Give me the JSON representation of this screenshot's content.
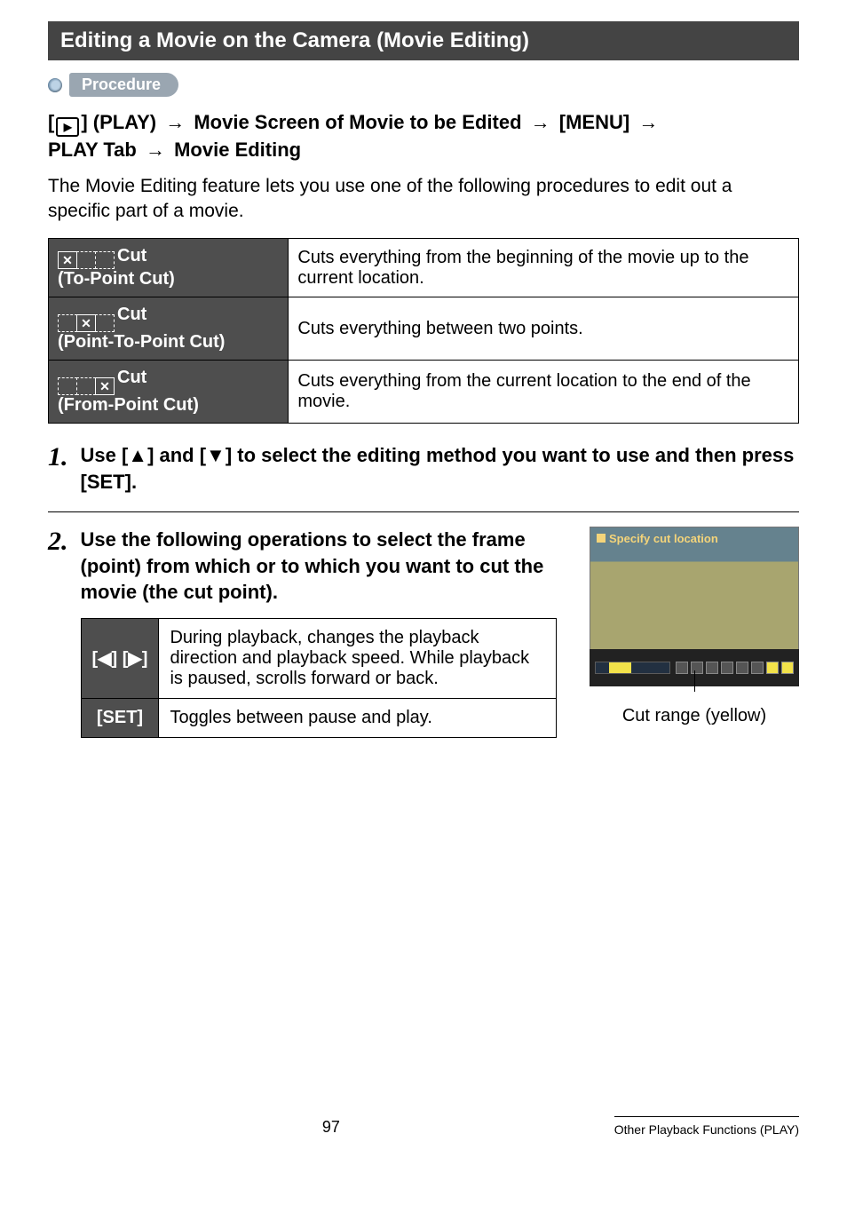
{
  "section_title": "Editing a Movie on the Camera (Movie Editing)",
  "procedure_label": "Procedure",
  "proc_line": {
    "pre": "[",
    "icon_glyph": "▶",
    "post1": "] (PLAY)",
    "seg1": "Movie Screen of Movie to be Edited",
    "seg2": "[MENU]",
    "line2a": "PLAY Tab",
    "line2b": "Movie Editing",
    "arrow": "→"
  },
  "intro": "The Movie Editing feature lets you use one of the following procedures to edit out a specific part of a movie.",
  "cut_table": [
    {
      "title": "Cut",
      "sub": "(To-Point Cut)",
      "desc": "Cuts everything from the beginning of the movie up to the current location.",
      "segments": [
        "x",
        "dash",
        "dash"
      ]
    },
    {
      "title": "Cut",
      "sub": "(Point-To-Point Cut)",
      "desc": "Cuts everything between two points.",
      "segments": [
        "dash",
        "x",
        "dash"
      ]
    },
    {
      "title": "Cut",
      "sub": "(From-Point Cut)",
      "desc": "Cuts everything from the current location to the end of the movie.",
      "segments": [
        "dash",
        "dash",
        "x"
      ]
    }
  ],
  "steps": [
    {
      "num": "1.",
      "text": "Use [▲] and [▼] to select the editing method you want to use and then press [SET]."
    },
    {
      "num": "2.",
      "text": "Use the following operations to select the frame (point) from which or to which you want to cut the movie (the cut point).",
      "ops": [
        {
          "key": "[◀] [▶]",
          "desc": "During playback, changes the playback direction and playback speed. While playback is paused, scrolls forward or back."
        },
        {
          "key": "[SET]",
          "desc": "Toggles between pause and play."
        }
      ],
      "thumb_title": "Specify cut location",
      "thumb_caption": "Cut range (yellow)"
    }
  ],
  "footer": {
    "page": "97",
    "section": "Other Playback Functions (PLAY)"
  }
}
